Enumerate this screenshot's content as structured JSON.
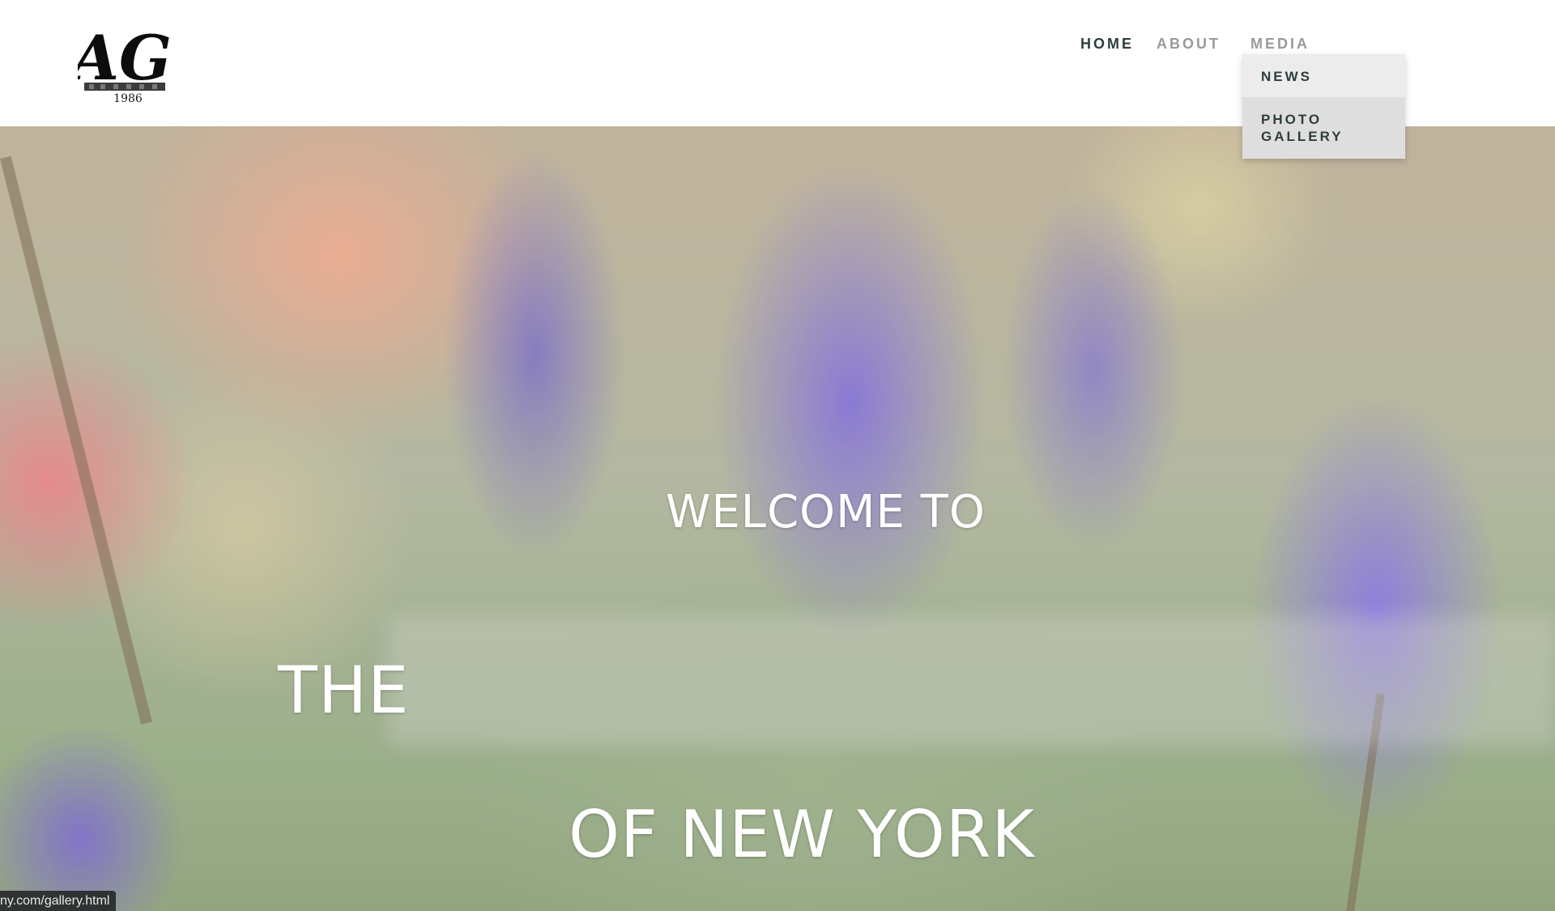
{
  "header": {
    "logo": {
      "monogram": "AG",
      "year": "1986"
    },
    "nav": {
      "home": "HOME",
      "about": "ABOUT",
      "media": "MEDIA"
    },
    "media_dropdown": {
      "items": [
        "NEWS",
        "PHOTO\nGALLERY"
      ]
    }
  },
  "hero": {
    "line1": "WELCOME TO",
    "line2": "THE",
    "line3": "OF NEW YORK"
  },
  "status_bar": {
    "url": "ny.com/gallery.html"
  },
  "colors": {
    "nav_active": "#2e3d3d",
    "nav_inactive": "#9a9a9a",
    "dropdown_bg": "#e6e6e6",
    "hero_text": "#ffffff"
  }
}
